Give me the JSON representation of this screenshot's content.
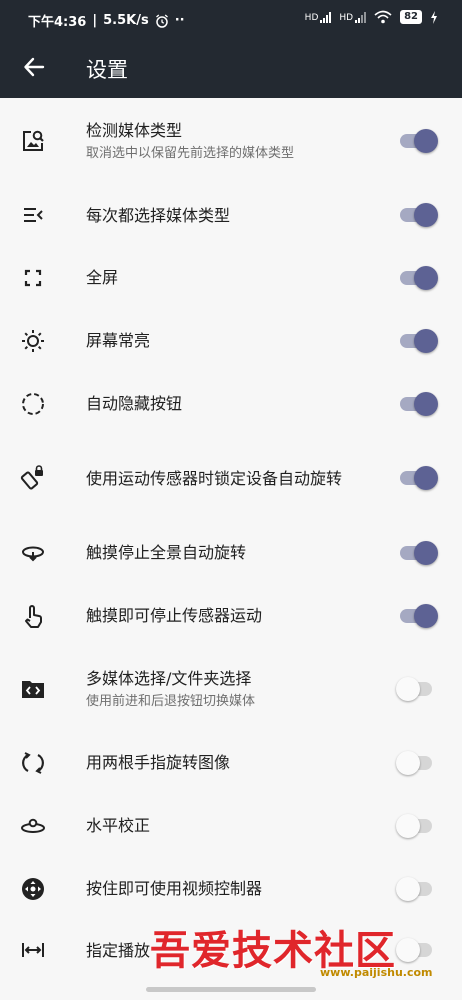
{
  "status_bar": {
    "time": "下午4:36",
    "speed": "5.5K/s",
    "dots": "··",
    "network_labels": [
      "HD",
      "HD"
    ],
    "battery": "82"
  },
  "header": {
    "title": "设置"
  },
  "settings": [
    {
      "icon": "image-search-icon",
      "title": "检测媒体类型",
      "subtitle": "取消选中以保留先前选择的媒体类型",
      "on": true
    },
    {
      "icon": "list-arrow-icon",
      "title": "每次都选择媒体类型",
      "subtitle": "",
      "on": true
    },
    {
      "icon": "fullscreen-icon",
      "title": "全屏",
      "subtitle": "",
      "on": true
    },
    {
      "icon": "brightness-icon",
      "title": "屏幕常亮",
      "subtitle": "",
      "on": true
    },
    {
      "icon": "dashed-circle-icon",
      "title": "自动隐藏按钮",
      "subtitle": "",
      "on": true
    },
    {
      "icon": "rotation-lock-icon",
      "title": "使用运动传感器时锁定设备自动旋转",
      "subtitle": "",
      "on": true
    },
    {
      "icon": "panorama-rotate-icon",
      "title": "触摸停止全景自动旋转",
      "subtitle": "",
      "on": true
    },
    {
      "icon": "touch-icon",
      "title": "触摸即可停止传感器运动",
      "subtitle": "",
      "on": true
    },
    {
      "icon": "folder-code-icon",
      "title": "多媒体选择/文件夹选择",
      "subtitle": "使用前进和后退按钮切换媒体",
      "on": false
    },
    {
      "icon": "rotate-arrows-icon",
      "title": "用两根手指旋转图像",
      "subtitle": "",
      "on": false
    },
    {
      "icon": "horizon-level-icon",
      "title": "水平校正",
      "subtitle": "",
      "on": false
    },
    {
      "icon": "gamepad-icon",
      "title": "按住即可使用视频控制器",
      "subtitle": "",
      "on": false
    },
    {
      "icon": "width-arrows-icon",
      "title": "指定播放",
      "subtitle": "",
      "on": false
    }
  ],
  "watermark": {
    "text": "吾爱技术社区",
    "url": "www.paijishu.com"
  },
  "colors": {
    "toggle_on_thumb": "#5d6294",
    "toggle_on_track": "#a5a9c2",
    "toolbar": "#232931"
  }
}
